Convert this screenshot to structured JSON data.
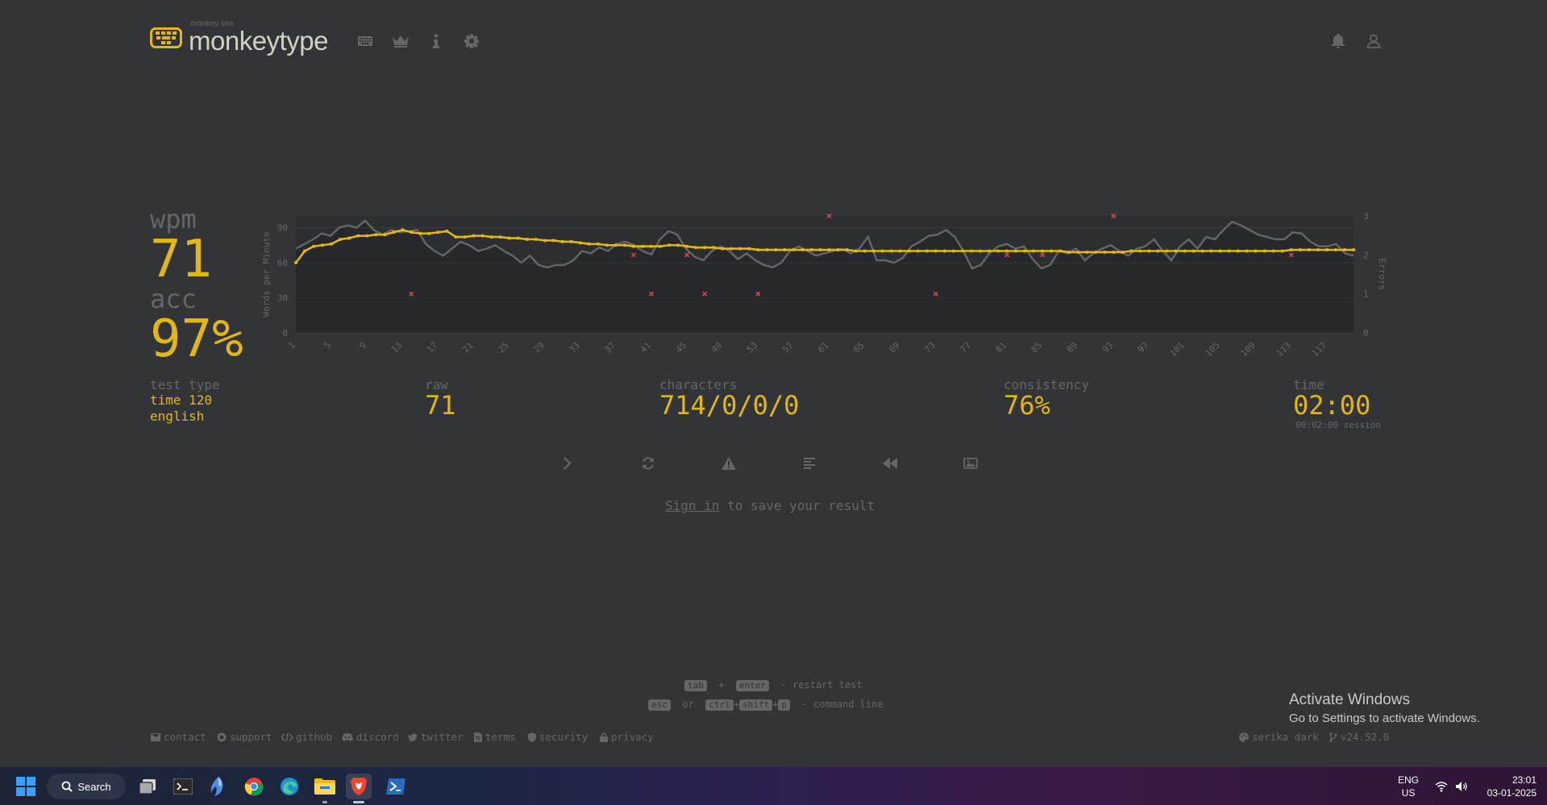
{
  "header": {
    "logo_sub": "monkey see",
    "logo_main": "monkeytype"
  },
  "result": {
    "wpm_label": "wpm",
    "wpm": "71",
    "acc_label": "acc",
    "acc": "97%",
    "test_type_label": "test type",
    "test_type_mode": "time 120",
    "test_type_lang": "english",
    "raw_label": "raw",
    "raw": "71",
    "characters_label": "characters",
    "characters": "714/0/0/0",
    "consistency_label": "consistency",
    "consistency": "76%",
    "time_label": "time",
    "time": "02:00",
    "session": "00:02:00 session"
  },
  "signin": {
    "link": "Sign in",
    "rest": " to save your result"
  },
  "hints": {
    "key_tab": "tab",
    "plus": "+",
    "key_enter": "enter",
    "restart": "- restart test",
    "key_esc": "esc",
    "or": "or",
    "key_ctrl": "ctrl",
    "key_shift": "shift",
    "key_p": "p",
    "command": "- command line"
  },
  "footer": {
    "contact": "contact",
    "support": "support",
    "github": "github",
    "discord": "discord",
    "twitter": "twitter",
    "terms": "terms",
    "security": "security",
    "privacy": "privacy",
    "theme": "serika dark",
    "version": "v24.52.0"
  },
  "watermark": {
    "title": "Activate Windows",
    "subtitle": "Go to Settings to activate Windows."
  },
  "taskbar": {
    "search": "Search",
    "lang_top": "ENG",
    "lang_bottom": "US",
    "time": "23:01",
    "date": "03-01-2025"
  },
  "colors": {
    "background": "#323437",
    "accent": "#e2b714",
    "text_sub": "#646669",
    "text": "#d1d0c5",
    "error": "#ca4754"
  },
  "chart_data": {
    "type": "line",
    "ylabel": "Words per Minute",
    "y2label": "Errors",
    "ylim": [
      0,
      100
    ],
    "y2lim": [
      0,
      3
    ],
    "yticks": [
      0,
      30,
      60,
      90
    ],
    "y2ticks": [
      0,
      1,
      2,
      3
    ],
    "xticks": [
      1,
      5,
      9,
      13,
      17,
      21,
      25,
      29,
      33,
      37,
      41,
      45,
      49,
      53,
      57,
      61,
      65,
      69,
      73,
      77,
      81,
      85,
      89,
      93,
      97,
      101,
      105,
      109,
      113,
      117
    ],
    "series": [
      {
        "name": "wpm",
        "color": "#e2b714",
        "values": [
          60,
          70,
          74,
          75,
          76,
          80,
          81,
          83,
          83,
          84,
          84,
          86,
          88,
          86,
          85,
          85,
          86,
          87,
          82,
          82,
          83,
          83,
          82,
          82,
          81,
          81,
          80,
          80,
          79,
          79,
          78,
          78,
          77,
          76,
          76,
          75,
          75,
          75,
          74,
          74,
          74,
          74,
          75,
          75,
          74,
          73,
          73,
          73,
          72,
          72,
          72,
          72,
          71,
          71,
          71,
          71,
          71,
          71,
          71,
          71,
          71,
          71,
          71,
          70,
          70,
          70,
          70,
          70,
          70,
          70,
          70,
          70,
          70,
          70,
          70,
          70,
          70,
          70,
          70,
          70,
          70,
          70,
          70,
          70,
          70,
          70,
          70,
          69,
          69,
          69,
          69,
          69,
          69,
          69,
          70,
          70,
          70,
          70,
          70,
          70,
          70,
          70,
          70,
          70,
          70,
          70,
          70,
          70,
          70,
          70,
          70,
          70,
          71,
          71,
          71,
          71,
          71,
          71,
          71,
          71
        ]
      },
      {
        "name": "raw",
        "color": "#646669",
        "values": [
          72,
          76,
          80,
          85,
          83,
          90,
          92,
          90,
          96,
          88,
          84,
          88,
          86,
          87,
          88,
          76,
          70,
          66,
          72,
          78,
          75,
          70,
          72,
          75,
          70,
          66,
          60,
          66,
          58,
          56,
          58,
          58,
          62,
          70,
          68,
          73,
          70,
          76,
          78,
          75,
          70,
          67,
          80,
          87,
          84,
          72,
          65,
          62,
          70,
          74,
          70,
          63,
          68,
          62,
          58,
          56,
          60,
          70,
          74,
          70,
          66,
          68,
          70,
          72,
          68,
          72,
          82,
          62,
          62,
          60,
          64,
          74,
          78,
          83,
          84,
          88,
          82,
          70,
          55,
          58,
          68,
          74,
          76,
          72,
          74,
          63,
          55,
          58,
          70,
          68,
          72,
          62,
          68,
          72,
          75,
          70,
          66,
          72,
          74,
          80,
          70,
          62,
          74,
          80,
          72,
          82,
          80,
          88,
          95,
          92,
          88,
          84,
          82,
          80,
          80,
          86,
          85,
          78,
          74,
          74,
          76,
          68,
          66
        ]
      },
      {
        "name": "errors",
        "color": "#ca4754",
        "points": [
          [
            14,
            1
          ],
          [
            39,
            2
          ],
          [
            41,
            1
          ],
          [
            45,
            2
          ],
          [
            47,
            1
          ],
          [
            53,
            1
          ],
          [
            61,
            3
          ],
          [
            73,
            1
          ],
          [
            81,
            2
          ],
          [
            85,
            2
          ],
          [
            93,
            3
          ],
          [
            113,
            2
          ]
        ]
      }
    ]
  }
}
